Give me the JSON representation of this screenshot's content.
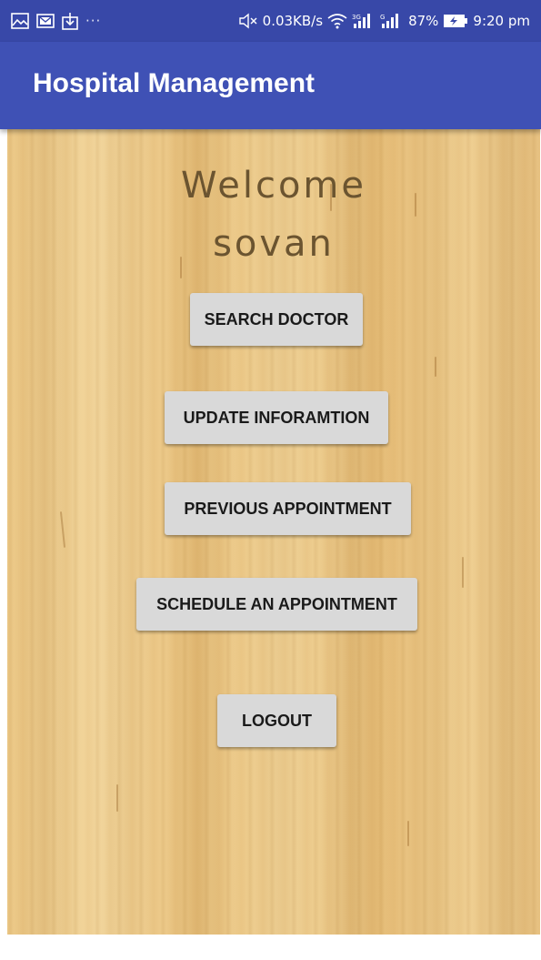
{
  "status_bar": {
    "left_icons": [
      "image-icon",
      "email-icon",
      "download-icon"
    ],
    "overflow": "···",
    "network_speed": "0.03KB/s",
    "battery_percent": "87%",
    "time": "9:20 pm"
  },
  "app_bar": {
    "title": "Hospital Management"
  },
  "welcome": {
    "line1": "Welcome",
    "line2": "sovan"
  },
  "buttons": {
    "search_doctor": "SEARCH DOCTOR",
    "update_information": "UPDATE INFORAMTION",
    "previous_appointment": "PREVIOUS APPOINTMENT",
    "schedule_appointment": "SCHEDULE AN APPOINTMENT",
    "logout": "LOGOUT"
  },
  "colors": {
    "status_bar": "#3848a8",
    "app_bar": "#3f51b5",
    "button_bg": "#d9d9d9",
    "welcome_text": "#6b5430"
  }
}
